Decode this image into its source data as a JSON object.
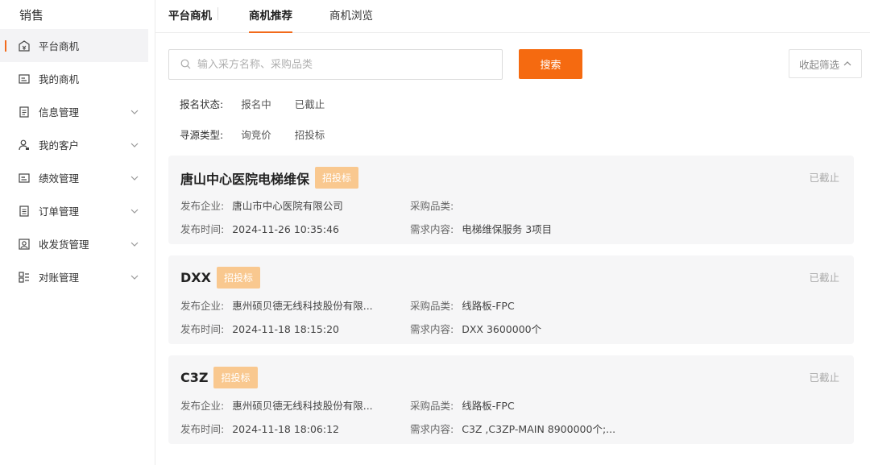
{
  "sidebar": {
    "title": "销售",
    "items": [
      {
        "label": "平台商机",
        "icon": "store-icon",
        "active": true,
        "expandable": false
      },
      {
        "label": "我的商机",
        "icon": "card-icon",
        "active": false,
        "expandable": false
      },
      {
        "label": "信息管理",
        "icon": "document-icon",
        "active": false,
        "expandable": true
      },
      {
        "label": "我的客户",
        "icon": "customer-icon",
        "active": false,
        "expandable": true
      },
      {
        "label": "绩效管理",
        "icon": "performance-icon",
        "active": false,
        "expandable": true
      },
      {
        "label": "订单管理",
        "icon": "order-icon",
        "active": false,
        "expandable": true
      },
      {
        "label": "收发货管理",
        "icon": "delivery-icon",
        "active": false,
        "expandable": true
      },
      {
        "label": "对账管理",
        "icon": "reconcile-icon",
        "active": false,
        "expandable": true
      }
    ]
  },
  "tabs": [
    {
      "label": "平台商机"
    },
    {
      "label": "商机推荐"
    },
    {
      "label": "商机浏览"
    }
  ],
  "search": {
    "placeholder": "输入采方名称、采购品类",
    "button": "搜索",
    "collapse": "收起筛选"
  },
  "filters": [
    {
      "label": "报名状态:",
      "options": [
        "报名中",
        "已截止"
      ]
    },
    {
      "label": "寻源类型:",
      "options": [
        "询竞价",
        "招投标"
      ]
    }
  ],
  "cards": [
    {
      "title": "唐山中心医院电梯维保",
      "tag": "招投标",
      "status": "已截止",
      "company_label": "发布企业:",
      "company": "唐山市中心医院有限公司",
      "category_label": "采购品类:",
      "category": "",
      "time_label": "发布时间:",
      "time": "2024-11-26 10:35:46",
      "demand_label": "需求内容:",
      "demand": "电梯维保服务 3项目"
    },
    {
      "title": "DXX",
      "tag": "招投标",
      "status": "已截止",
      "company_label": "发布企业:",
      "company": "惠州硕贝德无线科技股份有限...",
      "category_label": "采购品类:",
      "category": "线路板-FPC",
      "time_label": "发布时间:",
      "time": "2024-11-18 18:15:20",
      "demand_label": "需求内容:",
      "demand": "DXX 3600000个"
    },
    {
      "title": "C3Z",
      "tag": "招投标",
      "status": "已截止",
      "company_label": "发布企业:",
      "company": "惠州硕贝德无线科技股份有限...",
      "category_label": "采购品类:",
      "category": "线路板-FPC",
      "time_label": "发布时间:",
      "time": "2024-11-18 18:06:12",
      "demand_label": "需求内容:",
      "demand": "C3Z ,C3ZP-MAIN 8900000个;..."
    }
  ],
  "colors": {
    "accent": "#f56a10",
    "tag": "#f9c88f",
    "card_bg": "#f6f6f7"
  }
}
